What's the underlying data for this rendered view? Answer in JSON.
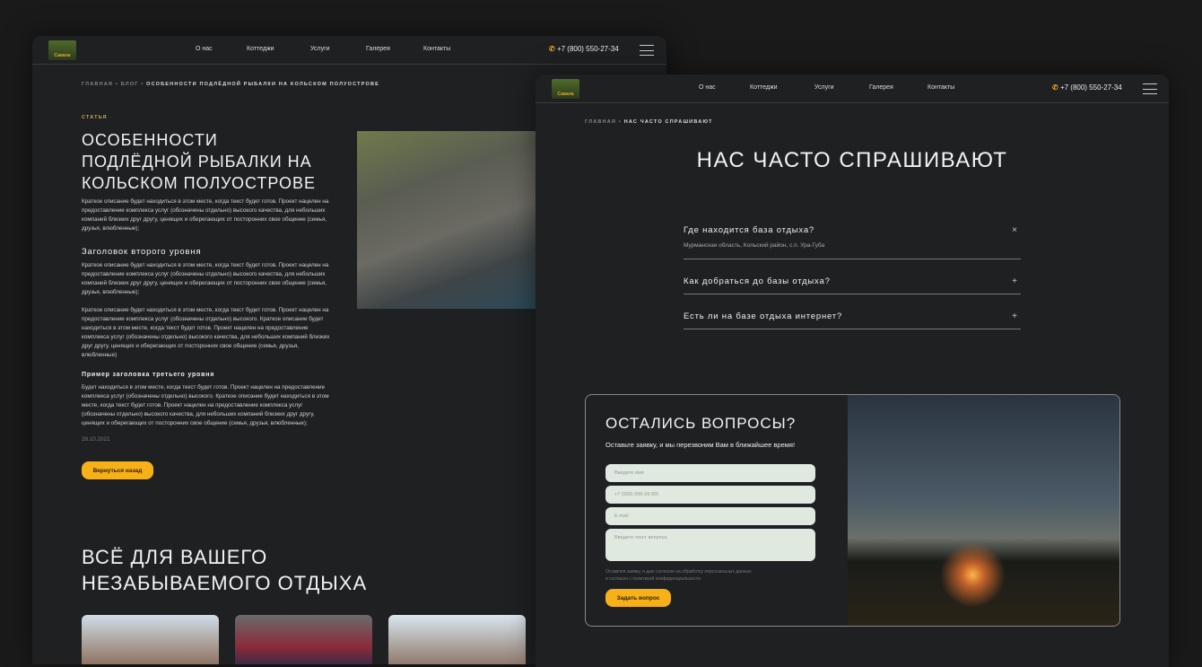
{
  "header": {
    "logo": "Савала",
    "nav": [
      "О нас",
      "Коттеджи",
      "Услуги",
      "Галерея",
      "Контакты"
    ],
    "phone": "+7 (800) 550-27-34"
  },
  "article": {
    "breadcrumb": [
      "Главная",
      "Блог",
      "Особенности подлёдной рыбалки на Кольском полуострове"
    ],
    "tag": "СТАТЬЯ",
    "title": "ОСОБЕННОСТИ ПОДЛЁДНОЙ РЫБАЛКИ НА КОЛЬСКОМ ПОЛУОСТРОВЕ",
    "intro": "Краткое описание будет находиться в этом месте, когда текст будет готов. Проект нацелен на предоставление комплекса услуг (обозначены отдельно) высокого качества, для небольших компаний близких друг другу, ценящих и оберегающих от посторонних свое общение (семья, друзья, влюбленные);",
    "h2": "Заголовок второго уровня",
    "p2": "Краткое описание будет находиться в этом месте, когда текст будет готов. Проект нацелен на предоставление комплекса услуг (обозначены отдельно) высокого качества, для небольших компаний близких друг другу, ценящих и оберегающих от посторонних свое общение (семья, друзья, влюбленные);",
    "p3": "Краткое описание будет находиться в этом месте, когда текст будет готов. Проект нацелен на предоставление комплекса услуг (обозначены отдельно) высокого. Краткое описание будет находиться в этом месте, когда текст будет готов. Проект нацелен на предоставление комплекса услуг (обозначены отдельно) высокого качества, для небольших компаний близких друг другу, ценящих и оберегающих от посторонних свое общение (семья, друзья, влюбленные)",
    "h3": "Пример заголовка третьего уровня",
    "p4": "Будет находиться в этом месте, когда текст будет готов. Проект нацелен на предоставление комплекса услуг (обозначены отдельно) высокого. Краткое описание будет находиться в этом месте, когда текст будет готов. Проект нацелен на предоставление комплекса услуг (обозначены отдельно) высокого качества, для небольших компаний близких друг другу, ценящих и оберегающих от посторонних свое общение (семья, друзья, влюбленные);",
    "date": "28.10.2021",
    "back": "Вернуться назад",
    "section_title": "ВСЁ ДЛЯ ВАШЕГО НЕЗАБЫВАЕМОГО ОТДЫХА"
  },
  "faq_page": {
    "breadcrumb": [
      "Главная",
      "Нас часто спрашивают"
    ],
    "title": "НАС ЧАСТО СПРАШИВАЮТ",
    "items": [
      {
        "q": "Где находится база отдыха?",
        "a": "Мурманская область, Кольский район, с.п. Ура-Губа",
        "icon": "×"
      },
      {
        "q": "Как добраться до базы отдыха?",
        "icon": "+"
      },
      {
        "q": "Есть ли на базе отдыха интернет?",
        "icon": "+"
      }
    ],
    "form": {
      "title": "ОСТАЛИСЬ ВОПРОСЫ?",
      "subtitle": "Оставьте заявку, и мы перезвоним Вам в ближайшее время!",
      "name_ph": "Введите имя",
      "phone_ph": "+7 (999) 999-99-99)",
      "email_ph": "E-mail",
      "question_ph": "Введите текст вопроса",
      "consent": "Оставляя заявку, я даю согласие на обработку персональных данных и согласен с политикой конфиденциальности",
      "submit": "Задать вопрос"
    }
  },
  "colors": {
    "accent": "#f7b118",
    "bg": "#1e2022"
  }
}
